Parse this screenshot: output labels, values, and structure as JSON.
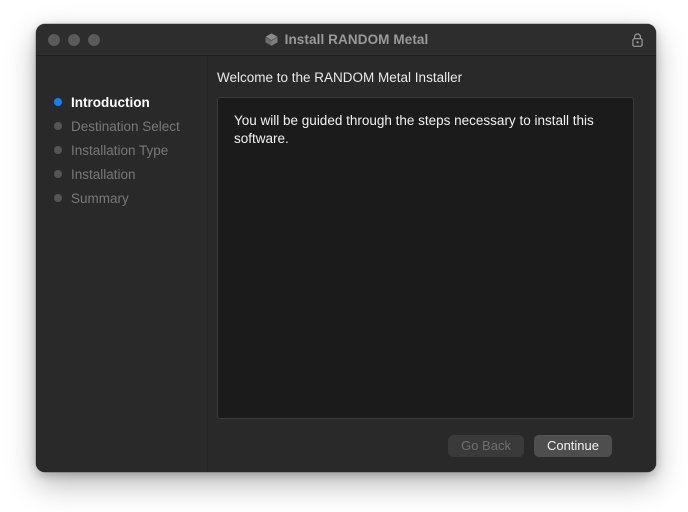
{
  "window": {
    "title": "Install RANDOM Metal",
    "title_icon": "package-icon",
    "lock_icon": "lock-closed-icon",
    "traffic_lights": [
      {
        "name": "close",
        "label": "Close"
      },
      {
        "name": "minimize",
        "label": "Minimize"
      },
      {
        "name": "zoom",
        "label": "Zoom"
      }
    ]
  },
  "sidebar": {
    "steps": [
      {
        "label": "Introduction",
        "active": true
      },
      {
        "label": "Destination Select",
        "active": false
      },
      {
        "label": "Installation Type",
        "active": false
      },
      {
        "label": "Installation",
        "active": false
      },
      {
        "label": "Summary",
        "active": false
      }
    ]
  },
  "content": {
    "header": "Welcome to the RANDOM Metal Installer",
    "body": "You will be guided through the steps necessary to install this software."
  },
  "footer": {
    "go_back_label": "Go Back",
    "continue_label": "Continue"
  },
  "colors": {
    "accent_active_step": "#0a84ff",
    "inactive_step_dot": "#555555",
    "window_background": "#292929",
    "panel_background": "#1b1b1b",
    "titlebar_background": "#2d2d2d",
    "title_text": "#9a9a9a",
    "continue_button": "#4e4e4e",
    "go_back_button": "#3a3a3a"
  }
}
